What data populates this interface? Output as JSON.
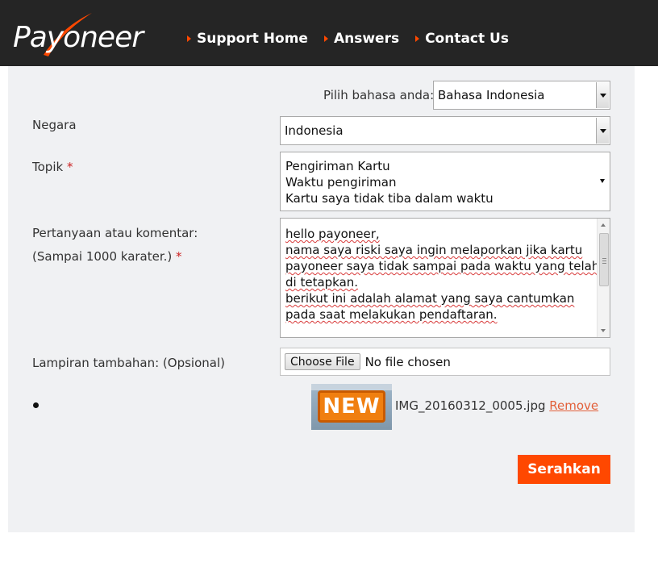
{
  "header": {
    "logo_text": "Payoneer",
    "nav": [
      {
        "label": "Support Home"
      },
      {
        "label": "Answers"
      },
      {
        "label": "Contact Us"
      }
    ]
  },
  "form": {
    "language": {
      "label": "Pilih bahasa anda:",
      "value": "Bahasa Indonesia"
    },
    "country": {
      "label": "Negara",
      "value": "Indonesia"
    },
    "topic": {
      "label": "Topik",
      "required_mark": "*",
      "options": [
        "Pengiriman Kartu",
        "Waktu pengiriman",
        "Kartu saya tidak tiba dalam waktu"
      ]
    },
    "question": {
      "label": "Pertanyaan atau komentar:",
      "sublabel": "(Sampai 1000 karater.)",
      "required_mark": "*",
      "lines": [
        "hello payoneer,",
        "nama saya riski saya ingin melaporkan jika kartu",
        "payoneer saya tidak sampai pada waktu yang telah",
        "di tetapkan.",
        "berikut ini adalah alamat yang saya cantumkan",
        "pada saat melakukan pendaftaran."
      ]
    },
    "attachment": {
      "label": "Lampiran tambahan: (Opsional)",
      "button_label": "Choose File",
      "status": "No file chosen",
      "thumbnail_text": "NEW",
      "file_name": "IMG_20160312_0005.jpg",
      "remove_label": "Remove"
    },
    "submit_label": "Serahkan"
  },
  "colors": {
    "accent": "#ff4800",
    "header_bg": "#252525",
    "panel_bg": "#f0f1f3"
  }
}
